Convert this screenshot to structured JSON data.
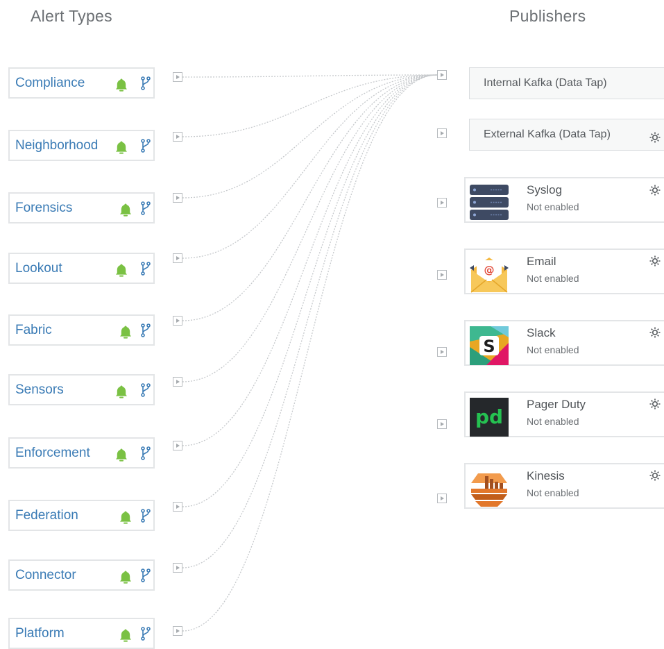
{
  "headings": {
    "alert_types": "Alert Types",
    "publishers": "Publishers"
  },
  "colors": {
    "label": "#3a7bb5",
    "bell": "#7ac143",
    "branch": "#3a7bb5",
    "link": "#c6c9cc"
  },
  "alert_types": [
    {
      "label": "Compliance",
      "icon": "bell-icon",
      "action_icon": "branch-icon"
    },
    {
      "label": "Neighborhood",
      "icon": "bell-icon",
      "action_icon": "branch-icon"
    },
    {
      "label": "Forensics",
      "icon": "bell-icon",
      "action_icon": "branch-icon"
    },
    {
      "label": "Lookout",
      "icon": "bell-icon",
      "action_icon": "branch-icon"
    },
    {
      "label": "Fabric",
      "icon": "bell-icon",
      "action_icon": "branch-icon"
    },
    {
      "label": "Sensors",
      "icon": "bell-icon",
      "action_icon": "branch-icon"
    },
    {
      "label": "Enforcement",
      "icon": "bell-icon",
      "action_icon": "branch-icon"
    },
    {
      "label": "Federation",
      "icon": "bell-icon",
      "action_icon": "branch-icon"
    },
    {
      "label": "Connector",
      "icon": "bell-icon",
      "action_icon": "branch-icon"
    },
    {
      "label": "Platform",
      "icon": "bell-icon",
      "action_icon": "branch-icon"
    }
  ],
  "publishers": {
    "internal_kafka": {
      "label": "Internal Kafka (Data Tap)"
    },
    "external_kafka": {
      "label": "External Kafka (Data Tap)",
      "icon": "gear-icon"
    },
    "items": [
      {
        "name": "Syslog",
        "status": "Not enabled",
        "logo": "syslog-logo",
        "icon": "gear-icon"
      },
      {
        "name": "Email",
        "status": "Not enabled",
        "logo": "email-logo",
        "icon": "gear-icon"
      },
      {
        "name": "Slack",
        "status": "Not enabled",
        "logo": "slack-logo",
        "icon": "gear-icon"
      },
      {
        "name": "Pager Duty",
        "status": "Not enabled",
        "logo": "pagerduty-logo",
        "icon": "gear-icon"
      },
      {
        "name": "Kinesis",
        "status": "Not enabled",
        "logo": "kinesis-logo",
        "icon": "gear-icon"
      }
    ]
  }
}
